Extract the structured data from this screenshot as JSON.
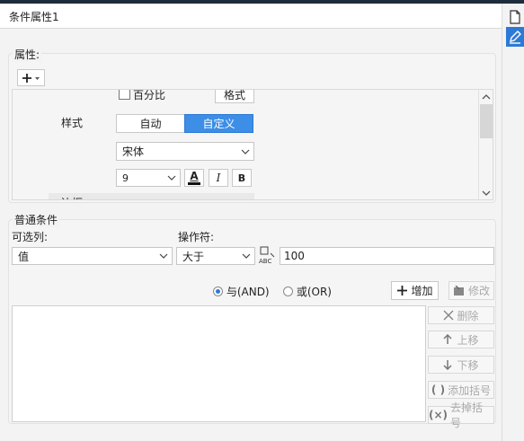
{
  "dialog": {
    "title": "条件属性1"
  },
  "side": {
    "icons": [
      "document-icon",
      "pencil-icon"
    ]
  },
  "props": {
    "section_label": "属性:",
    "add_label": "+",
    "percent_checkbox": "百分比",
    "format_button": "格式",
    "style_label": "样式",
    "style_auto": "自动",
    "style_custom": "自定义",
    "font_family": "宋体",
    "font_size": "9",
    "bold_label": "B",
    "italic_label": "I",
    "color_label": "A",
    "partial_label": "边框"
  },
  "cond": {
    "section_label": "普通条件",
    "column_label": "可选列:",
    "operator_label": "操作符:",
    "column_value": "值",
    "operator_value": "大于",
    "value": "100",
    "and_label": "与(AND)",
    "or_label": "或(OR)",
    "add_button": "增加",
    "modify_button": "修改",
    "delete_button": "删除",
    "move_up_button": "上移",
    "move_down_button": "下移",
    "add_parens_button": "添加括号",
    "remove_parens_button": "去掉括号"
  }
}
